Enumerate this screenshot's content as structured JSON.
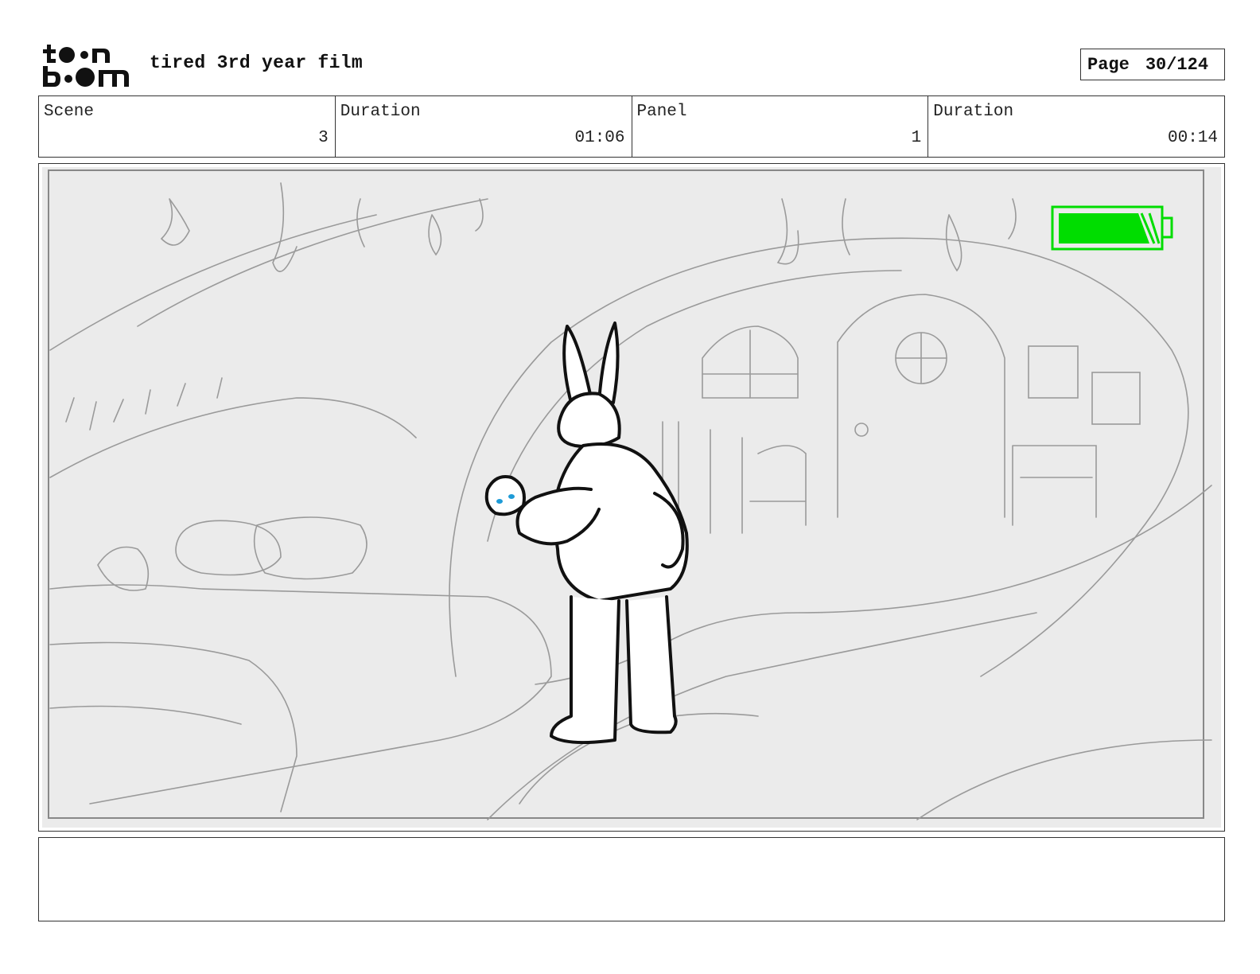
{
  "header": {
    "logo_text": "toon boom",
    "project_title": "tired 3rd year film",
    "page_label": "Page",
    "page_value": "30/124"
  },
  "info": {
    "scene_label": "Scene",
    "scene_value": "3",
    "scene_duration_label": "Duration",
    "scene_duration_value": "01:06",
    "panel_label": "Panel",
    "panel_value": "1",
    "panel_duration_label": "Duration",
    "panel_duration_value": "00:14"
  },
  "panel": {
    "sketch_subject": "rabbit-character",
    "battery_color": "#00dd00",
    "tear_color": "#1e9bd7"
  },
  "notes": {
    "text": ""
  }
}
